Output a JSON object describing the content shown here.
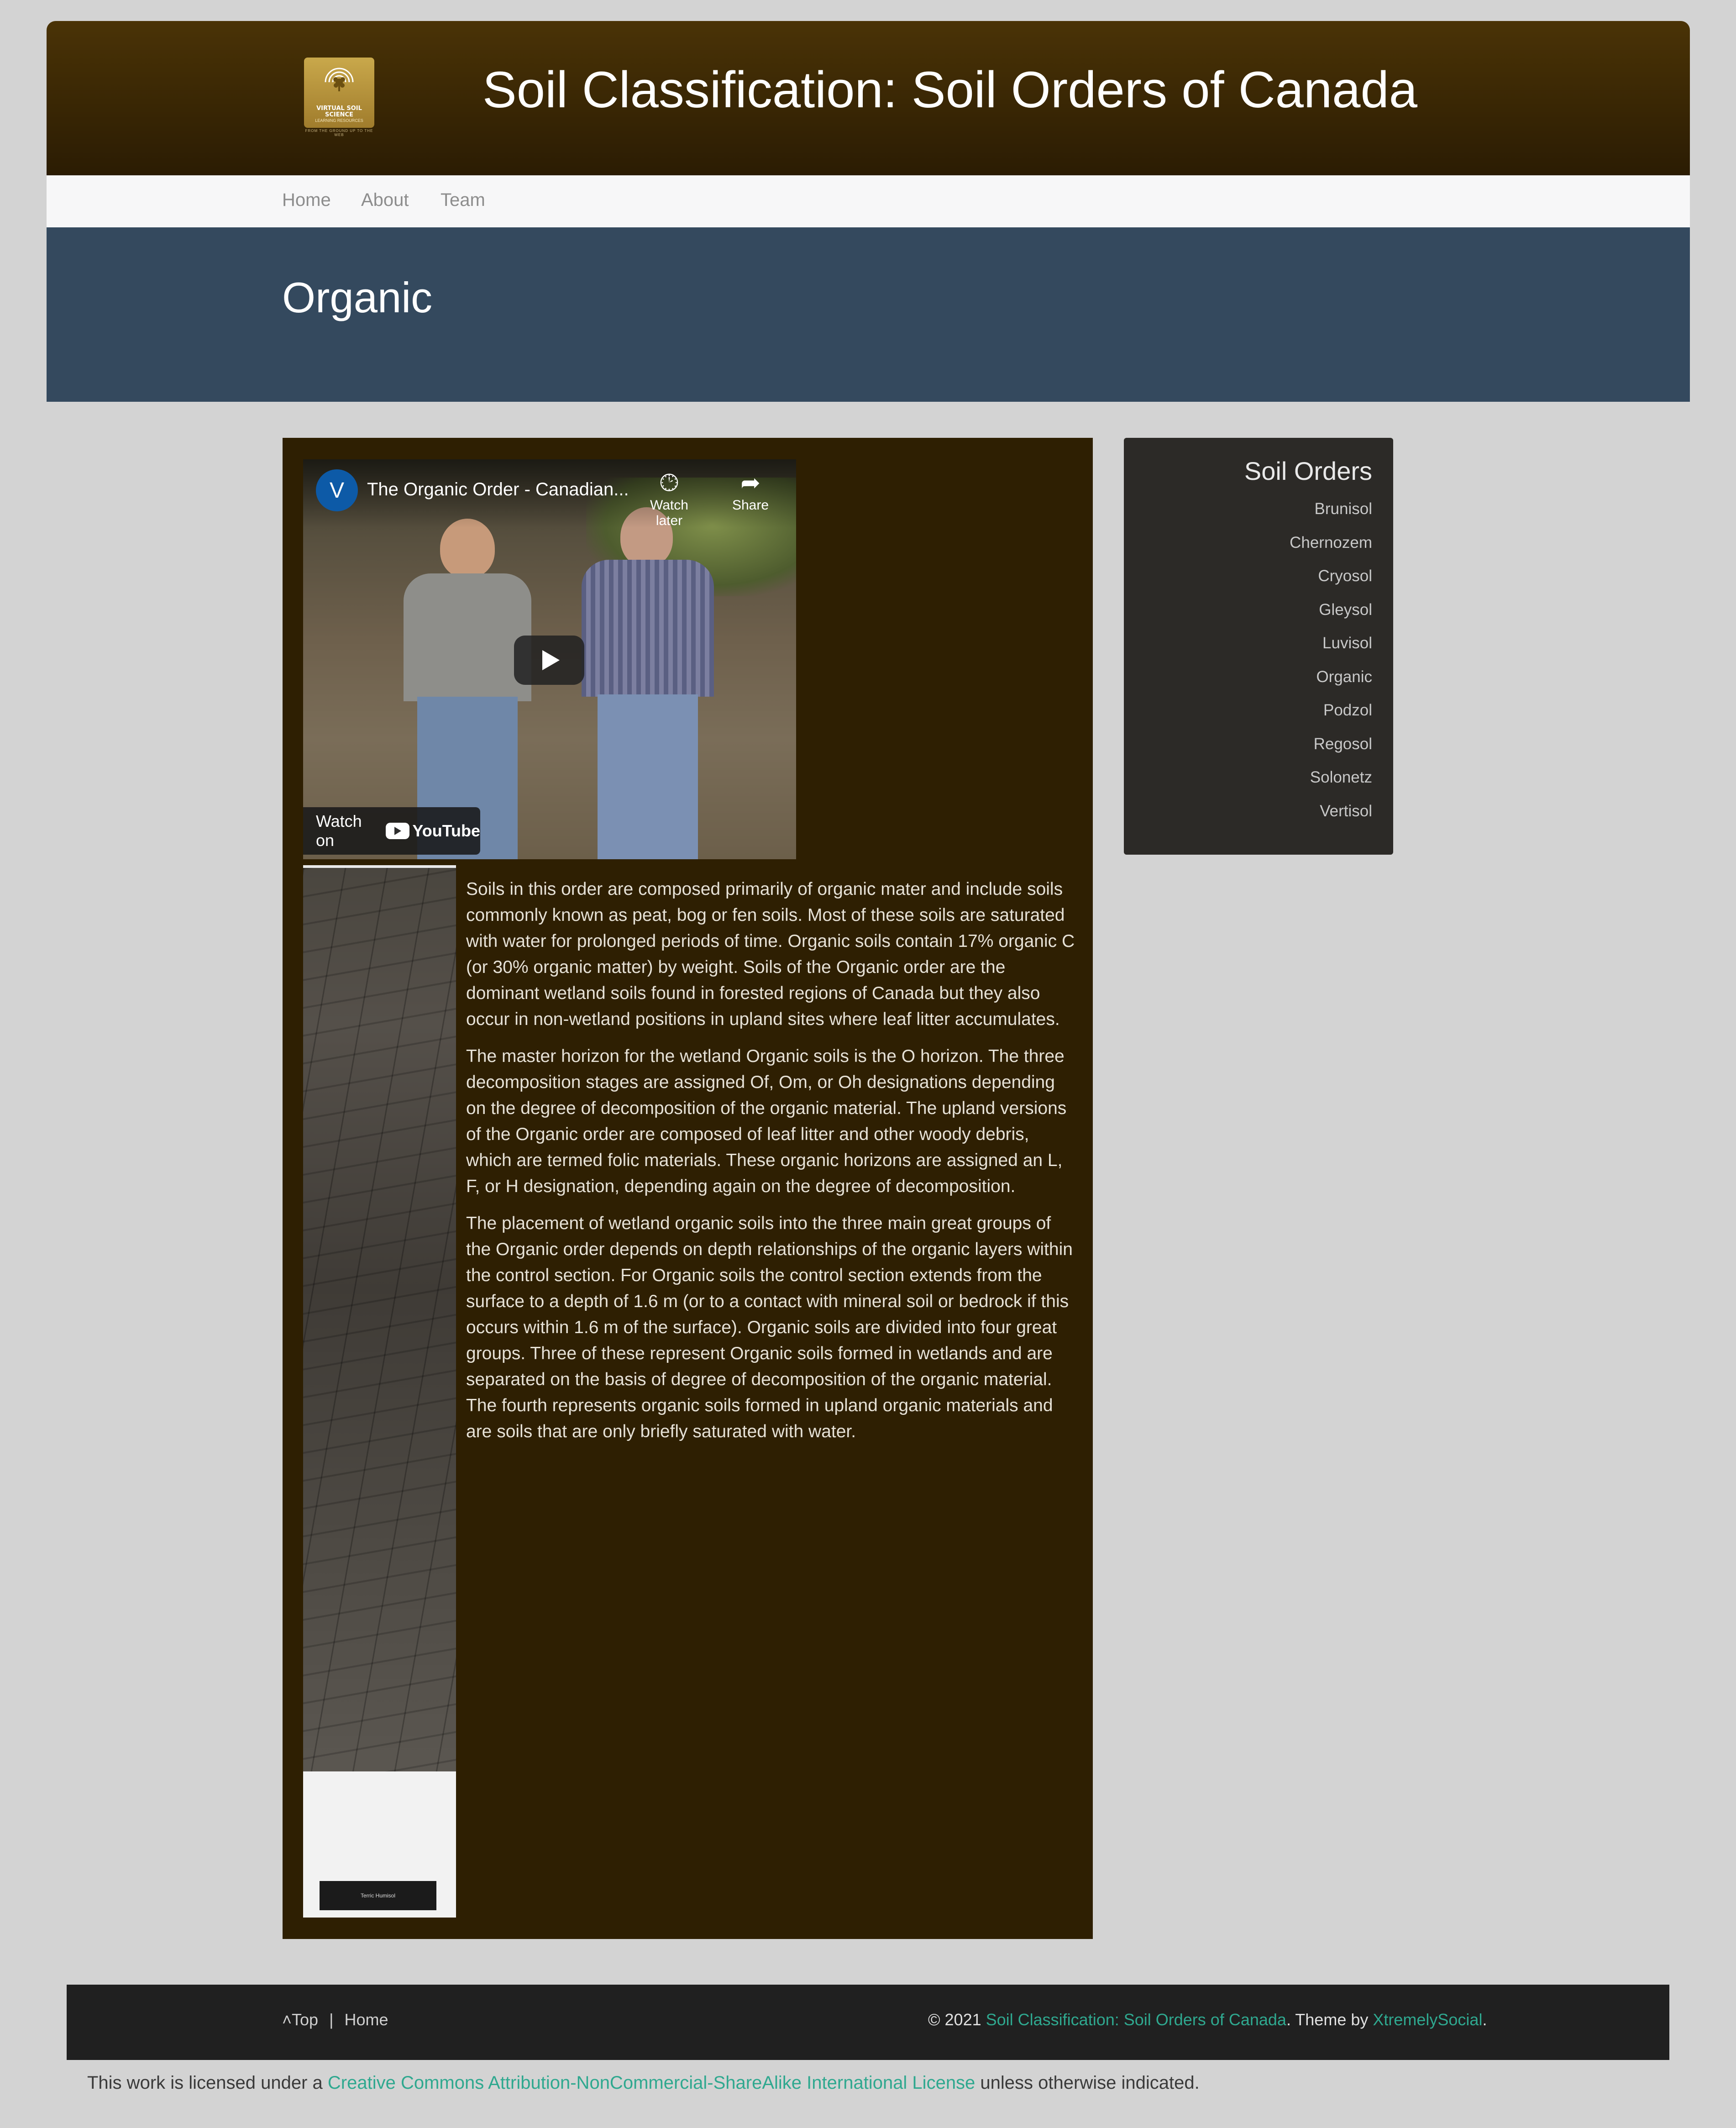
{
  "header": {
    "logo_line1": "VIRTUAL SOIL SCIENCE",
    "logo_line2": "LEARNING RESOURCES",
    "logo_tagline": "FROM THE GROUND UP TO THE WEB",
    "site_title": "Soil Classification: Soil Orders of Canada"
  },
  "nav": {
    "items": [
      {
        "label": "Home"
      },
      {
        "label": "About"
      },
      {
        "label": "Team"
      }
    ]
  },
  "page": {
    "title": "Organic"
  },
  "video": {
    "channel_initial": "V",
    "title": "The Organic Order - Canadian...",
    "watch_later_icon": "clock-icon",
    "watch_later_label": "Watch later",
    "share_icon": "share-arrow-icon",
    "share_label": "Share",
    "play_icon": "play-icon",
    "watch_on_label": "Watch on",
    "youtube_label": "YouTube"
  },
  "soil_profile": {
    "label": "Terric Humisol"
  },
  "content": {
    "paragraphs": [
      "Soils in this order are composed primarily of organic mater and include soils commonly known as peat, bog or fen soils. Most of these soils are saturated with water for prolonged periods of time. Organic soils contain 17% organic C (or 30% organic matter) by weight. Soils of the Organic order are the dominant wetland soils found in forested regions of Canada but they also occur in non-wetland positions in upland sites where leaf litter accumulates.",
      "The master horizon for the wetland Organic soils is the O horizon. The three decomposition stages are assigned Of, Om, or Oh designations depending on the degree of decomposition of the organic material. The upland versions of the Organic order are composed of leaf litter and other woody debris, which are termed folic materials. These organic horizons are assigned an L, F, or H designation, depending again on the degree of decomposition.",
      "The placement of wetland organic soils into the three main great groups of the Organic order depends on depth relationships of the organic layers within the control section. For Organic soils the control section extends from the surface to a depth of 1.6 m (or to a contact with mineral soil or bedrock if this occurs within 1.6 m of the surface). Organic soils are divided into four great groups. Three of these represent Organic soils formed in wetlands and are separated on the basis of degree of decomposition of the organic material. The fourth represents organic soils formed in upland organic materials and are soils that are only briefly saturated with water."
    ]
  },
  "sidebar": {
    "title": "Soil Orders",
    "items": [
      {
        "label": "Brunisol"
      },
      {
        "label": "Chernozem"
      },
      {
        "label": "Cryosol"
      },
      {
        "label": "Gleysol"
      },
      {
        "label": "Luvisol"
      },
      {
        "label": "Organic"
      },
      {
        "label": "Podzol"
      },
      {
        "label": "Regosol"
      },
      {
        "label": "Solonetz"
      },
      {
        "label": "Vertisol"
      }
    ]
  },
  "footer": {
    "top_icon": "chevron-up-icon",
    "top_label": "Top",
    "separator": "|",
    "home_label": "Home",
    "copyright_prefix": "© 2021 ",
    "site_link": "Soil Classification: Soil Orders of Canada",
    "theme_text": ". Theme by ",
    "theme_link": "XtremelySocial",
    "theme_end": "."
  },
  "license": {
    "prefix": "This work is licensed under a ",
    "link": "Creative Commons Attribution-NonCommercial-ShareAlike International License",
    "suffix": " unless otherwise indicated."
  },
  "colors": {
    "header_brown": "#4a3306",
    "nav_bg": "#f7f7f8",
    "title_band": "#34495e",
    "content_bg": "#2e1f02",
    "sidebar_bg": "#2c2a27",
    "footer_bg": "#202020",
    "link_teal": "#2fa88f",
    "page_bg": "#d3d3d3"
  }
}
